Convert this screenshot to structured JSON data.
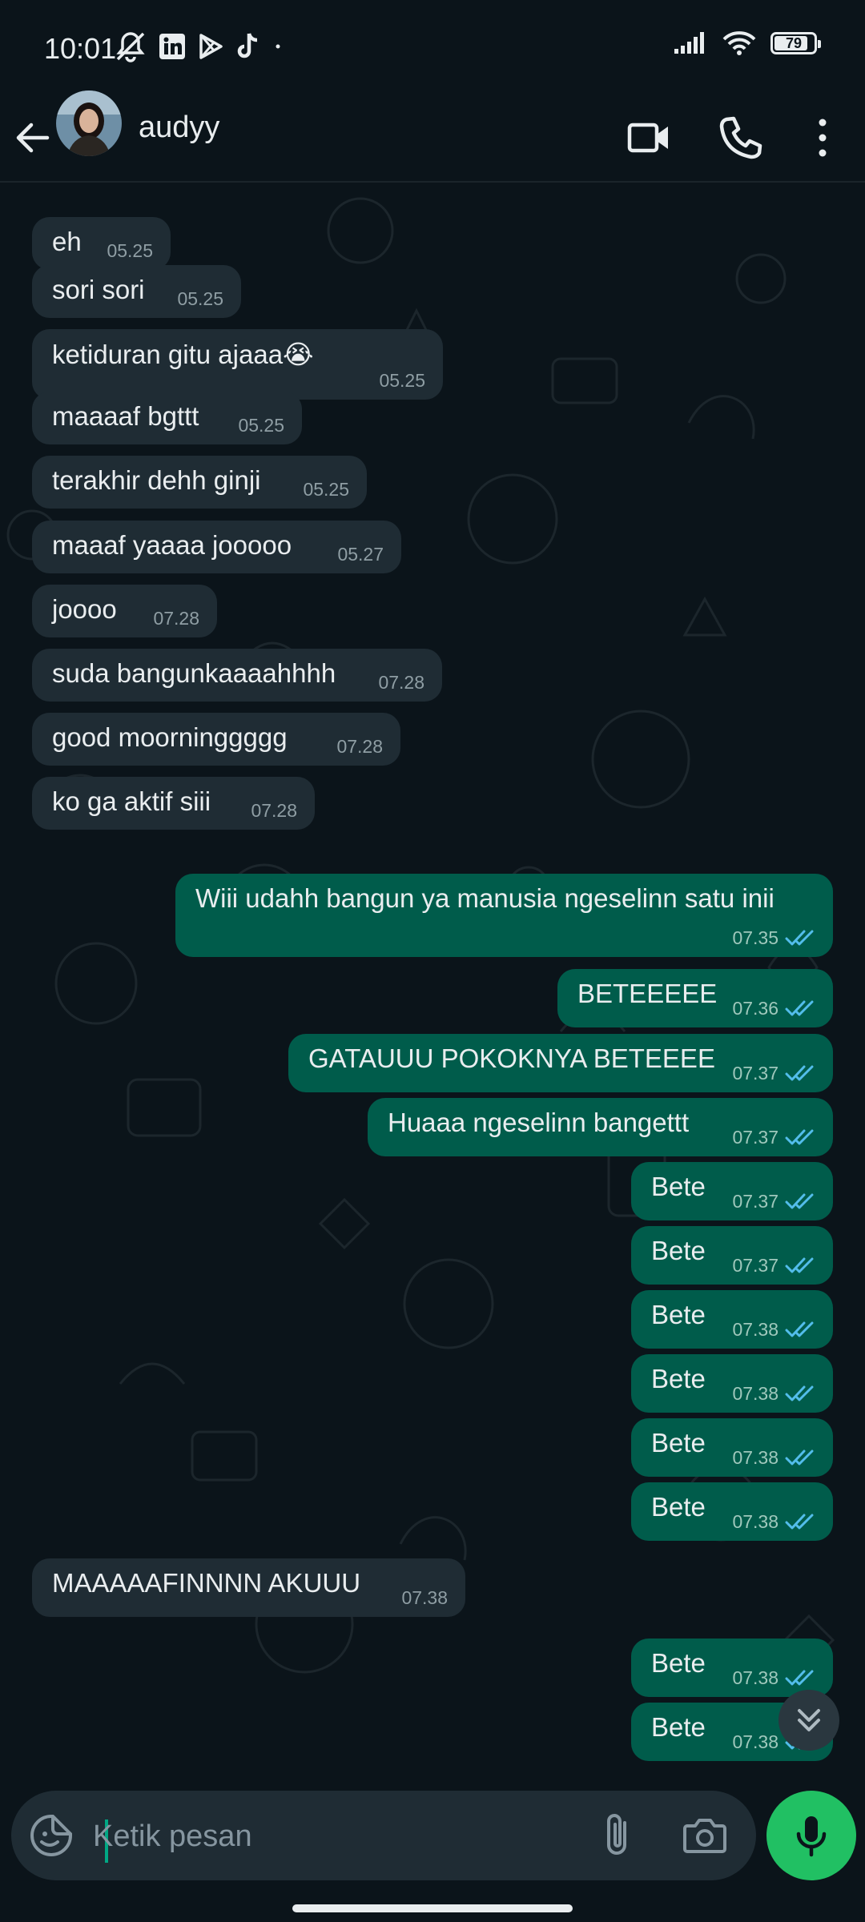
{
  "status_bar": {
    "time": "10:01",
    "battery": "79",
    "left_icons": [
      "mute-off-icon",
      "linkedin-icon",
      "play-store-icon",
      "tiktok-icon",
      "dot-icon"
    ],
    "right_icons": [
      "signal-icon",
      "wifi-icon",
      "battery-icon"
    ]
  },
  "header": {
    "contact_name": "audyy",
    "icons": [
      "back-arrow-icon",
      "avatar",
      "video-call-icon",
      "voice-call-icon",
      "more-options-icon"
    ]
  },
  "messages": [
    {
      "dir": "in",
      "text": "eh",
      "time": "05.25"
    },
    {
      "dir": "in",
      "text": "sori sori",
      "time": "05.25"
    },
    {
      "dir": "in",
      "text": "ketiduran gitu ajaaa😭",
      "time": "05.25"
    },
    {
      "dir": "in",
      "text": "maaaaf bgttt",
      "time": "05.25"
    },
    {
      "dir": "in",
      "text": "terakhir dehh ginji",
      "time": "05.25"
    },
    {
      "dir": "in",
      "text": "maaaf yaaaa jooooo",
      "time": "05.27"
    },
    {
      "dir": "in",
      "text": "joooo",
      "time": "07.28"
    },
    {
      "dir": "in",
      "text": "suda bangunkaaaahhhh",
      "time": "07.28"
    },
    {
      "dir": "in",
      "text": "good moorninggggg",
      "time": "07.28"
    },
    {
      "dir": "in",
      "text": "ko ga aktif siii",
      "time": "07.28"
    },
    {
      "dir": "out",
      "text": "Wiii udahh bangun ya manusia ngeselinn satu inii",
      "time": "07.35",
      "read": true
    },
    {
      "dir": "out",
      "text": "BETEEEEE",
      "time": "07.36",
      "read": true
    },
    {
      "dir": "out",
      "text": "GATAUUU POKOKNYA BETEEEE",
      "time": "07.37",
      "read": true
    },
    {
      "dir": "out",
      "text": "Huaaa ngeselinn bangettt",
      "time": "07.37",
      "read": true
    },
    {
      "dir": "out",
      "text": "Bete",
      "time": "07.37",
      "read": true
    },
    {
      "dir": "out",
      "text": "Bete",
      "time": "07.37",
      "read": true
    },
    {
      "dir": "out",
      "text": "Bete",
      "time": "07.38",
      "read": true
    },
    {
      "dir": "out",
      "text": "Bete",
      "time": "07.38",
      "read": true
    },
    {
      "dir": "out",
      "text": "Bete",
      "time": "07.38",
      "read": true
    },
    {
      "dir": "out",
      "text": "Bete",
      "time": "07.38",
      "read": true
    },
    {
      "dir": "in",
      "text": "MAAAAAFINNNN AKUUU",
      "time": "07.38"
    },
    {
      "dir": "out",
      "text": "Bete",
      "time": "07.38",
      "read": true
    },
    {
      "dir": "out",
      "text": "Bete",
      "time": "07.38",
      "read": true
    }
  ],
  "composer": {
    "placeholder": "Ketik pesan",
    "icons": [
      "sticker-icon",
      "attach-icon",
      "camera-icon",
      "mic-icon"
    ]
  },
  "colors": {
    "background": "#0b141a",
    "incoming_bubble": "#1f2c34",
    "outgoing_bubble": "#005c4b",
    "read_tick": "#53bdeb",
    "mic_button": "#21c063"
  }
}
